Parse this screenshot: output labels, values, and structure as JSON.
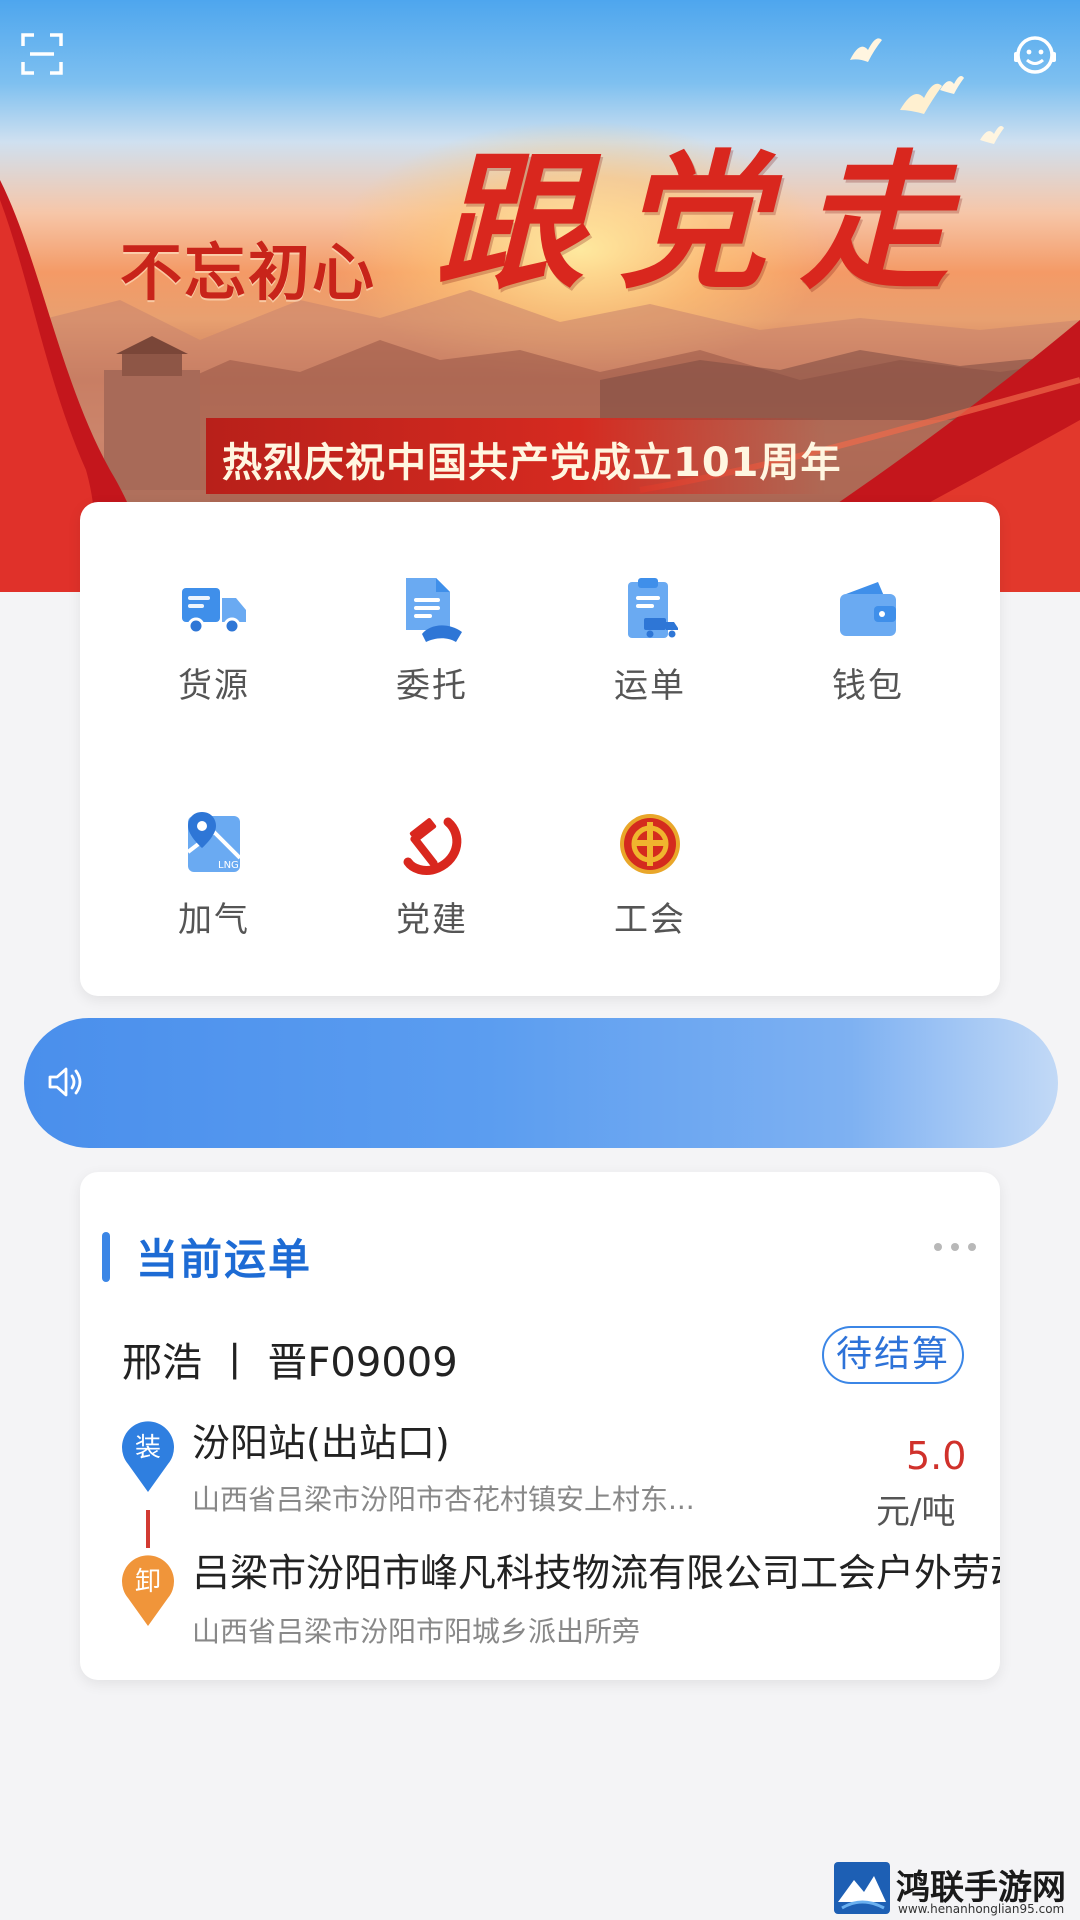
{
  "banner": {
    "slogan_left": "不忘初心",
    "slogan_big": "跟党走",
    "headline": "热烈庆祝中国共产党成立101周年"
  },
  "menu": [
    {
      "label": "货源",
      "icon": "truck-icon"
    },
    {
      "label": "委托",
      "icon": "document-hand-icon"
    },
    {
      "label": "运单",
      "icon": "clipboard-truck-icon"
    },
    {
      "label": "钱包",
      "icon": "wallet-icon"
    },
    {
      "label": "加气",
      "icon": "lng-map-icon"
    },
    {
      "label": "党建",
      "icon": "hammer-sickle-icon"
    },
    {
      "label": "工会",
      "icon": "union-emblem-icon"
    }
  ],
  "notice": {
    "icon": "speaker-icon",
    "text": ""
  },
  "order": {
    "title": "当前运单",
    "driver_line": "邢浩 丨 晋F09009",
    "status": "待结算",
    "load_tag": "装",
    "unload_tag": "卸",
    "load_name": "汾阳站(出站口)",
    "load_address": "山西省吕梁市汾阳市杏花村镇安上村东...",
    "unload_name": "吕梁市汾阳市峰凡科技物流有限公司工会户外劳动者爱",
    "unload_address": "山西省吕梁市汾阳市阳城乡派出所旁",
    "price": "5.0",
    "price_unit": "元/吨"
  },
  "watermark": {
    "title": "鸿联手游网",
    "url": "www.henanhonglian95.com"
  },
  "colors": {
    "primary_blue": "#3b86e6",
    "party_red": "#d9271e",
    "price_red": "#d0312b",
    "unload_orange": "#f0953a"
  }
}
